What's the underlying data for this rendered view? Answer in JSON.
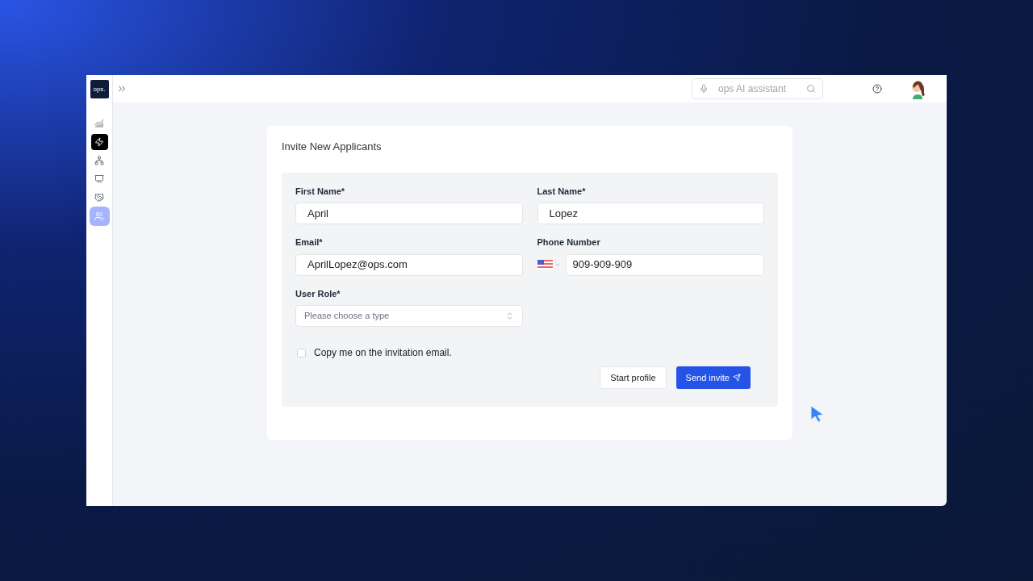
{
  "sidebar": {
    "logo": "ops.",
    "items": [
      {
        "selected": false,
        "active": false
      },
      {
        "selected": false,
        "active": true
      },
      {
        "selected": false,
        "active": false
      },
      {
        "selected": false,
        "active": false
      },
      {
        "selected": false,
        "active": false
      },
      {
        "selected": true,
        "active": false
      }
    ]
  },
  "topbar": {
    "assistant": {
      "placeholder": "ops AI assistant"
    }
  },
  "form": {
    "title": "Invite New Applicants",
    "fields": [
      {
        "kind": "text",
        "label": "First Name*",
        "value": "April"
      },
      {
        "kind": "text",
        "label": "Last Name*",
        "value": "Lopez"
      },
      {
        "kind": "text",
        "label": "Email*",
        "value": "AprilLopez@ops.com"
      },
      {
        "kind": "phone",
        "label": "Phone Number",
        "value": "909-909-909"
      },
      {
        "kind": "select",
        "label": "User Role*",
        "placeholder": "Please choose a type"
      }
    ],
    "copy_me": {
      "label": "Copy me on the invitation email.",
      "checked": false
    },
    "buttons": [
      {
        "kind": "secondary",
        "label": "Start profile"
      },
      {
        "kind": "primary",
        "label": "Send invite"
      }
    ]
  }
}
